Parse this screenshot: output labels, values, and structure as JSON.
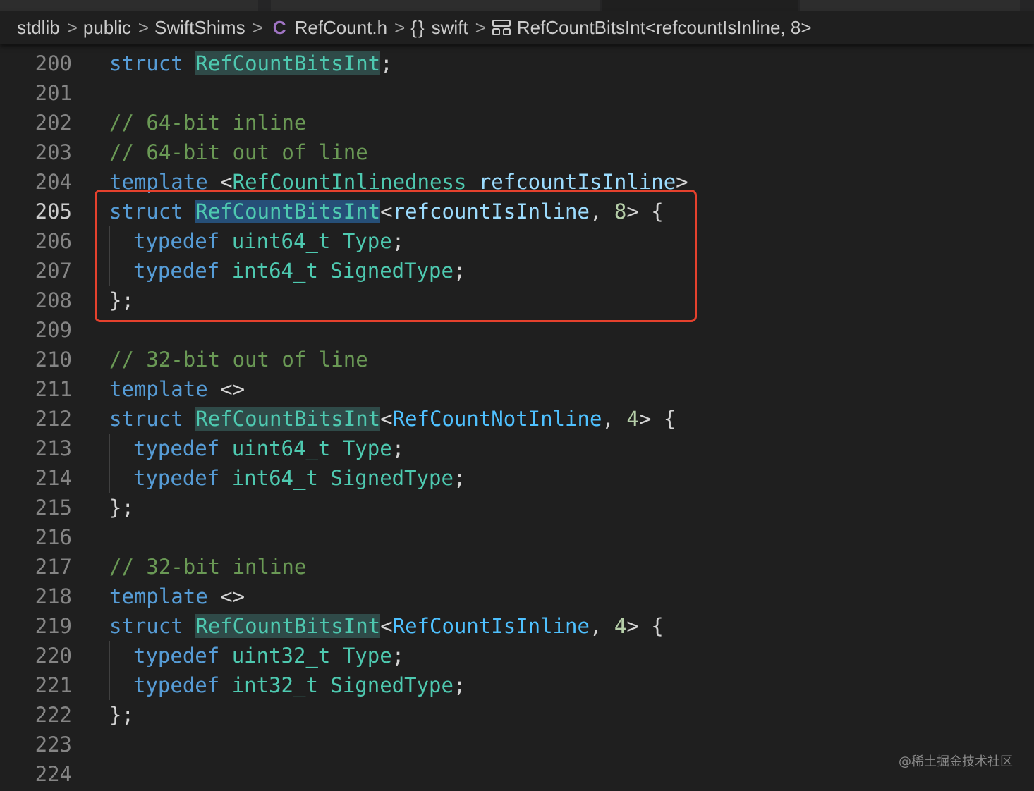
{
  "breadcrumb": {
    "items": [
      "stdlib",
      "public",
      "SwiftShims",
      "RefCount.h",
      "swift",
      "RefCountBitsInt<refcountIsInline, 8>"
    ],
    "separator": ">",
    "c_icon": "C",
    "brace_icon": "{}"
  },
  "editor": {
    "lines": [
      {
        "n": "200",
        "tokens": [
          [
            "kw",
            "struct"
          ],
          [
            "pu",
            " "
          ],
          [
            "ty-hl",
            "RefCountBitsInt"
          ],
          [
            "pu",
            ";"
          ]
        ]
      },
      {
        "n": "201",
        "tokens": []
      },
      {
        "n": "202",
        "tokens": [
          [
            "cm",
            "// 64-bit inline"
          ]
        ]
      },
      {
        "n": "203",
        "tokens": [
          [
            "cm",
            "// 64-bit out of line"
          ]
        ]
      },
      {
        "n": "204",
        "tokens": [
          [
            "kw",
            "template"
          ],
          [
            "pu",
            " <"
          ],
          [
            "ty",
            "RefCountInlinedness"
          ],
          [
            "pu",
            " "
          ],
          [
            "pa",
            "refcountIsInline"
          ],
          [
            "pu",
            ">"
          ]
        ]
      },
      {
        "n": "205",
        "active": true,
        "tokens": [
          [
            "kw",
            "struct"
          ],
          [
            "pu",
            " "
          ],
          [
            "ty-sel",
            "RefCountBitsInt"
          ],
          [
            "pu",
            "<"
          ],
          [
            "pa",
            "refcountIsInline"
          ],
          [
            "pu",
            ", "
          ],
          [
            "nu",
            "8"
          ],
          [
            "pu",
            "> {"
          ]
        ]
      },
      {
        "n": "206",
        "indent": true,
        "tokens": [
          [
            "kw",
            "typedef"
          ],
          [
            "pu",
            " "
          ],
          [
            "ty",
            "uint64_t"
          ],
          [
            "pu",
            " "
          ],
          [
            "ty",
            "Type"
          ],
          [
            "pu",
            ";"
          ]
        ]
      },
      {
        "n": "207",
        "indent": true,
        "tokens": [
          [
            "kw",
            "typedef"
          ],
          [
            "pu",
            " "
          ],
          [
            "ty",
            "int64_t"
          ],
          [
            "pu",
            " "
          ],
          [
            "ty",
            "SignedType"
          ],
          [
            "pu",
            ";"
          ]
        ]
      },
      {
        "n": "208",
        "tokens": [
          [
            "pu",
            "};"
          ]
        ]
      },
      {
        "n": "209",
        "tokens": []
      },
      {
        "n": "210",
        "tokens": [
          [
            "cm",
            "// 32-bit out of line"
          ]
        ]
      },
      {
        "n": "211",
        "tokens": [
          [
            "kw",
            "template"
          ],
          [
            "pu",
            " <>"
          ]
        ]
      },
      {
        "n": "212",
        "tokens": [
          [
            "kw",
            "struct"
          ],
          [
            "pu",
            " "
          ],
          [
            "ty-hl",
            "RefCountBitsInt"
          ],
          [
            "pu",
            "<"
          ],
          [
            "en",
            "RefCountNotInline"
          ],
          [
            "pu",
            ", "
          ],
          [
            "nu",
            "4"
          ],
          [
            "pu",
            "> {"
          ]
        ]
      },
      {
        "n": "213",
        "indent": true,
        "tokens": [
          [
            "kw",
            "typedef"
          ],
          [
            "pu",
            " "
          ],
          [
            "ty",
            "uint64_t"
          ],
          [
            "pu",
            " "
          ],
          [
            "ty",
            "Type"
          ],
          [
            "pu",
            ";"
          ]
        ]
      },
      {
        "n": "214",
        "indent": true,
        "tokens": [
          [
            "kw",
            "typedef"
          ],
          [
            "pu",
            " "
          ],
          [
            "ty",
            "int64_t"
          ],
          [
            "pu",
            " "
          ],
          [
            "ty",
            "SignedType"
          ],
          [
            "pu",
            ";"
          ]
        ]
      },
      {
        "n": "215",
        "tokens": [
          [
            "pu",
            "};"
          ]
        ]
      },
      {
        "n": "216",
        "tokens": []
      },
      {
        "n": "217",
        "tokens": [
          [
            "cm",
            "// 32-bit inline"
          ]
        ]
      },
      {
        "n": "218",
        "tokens": [
          [
            "kw",
            "template"
          ],
          [
            "pu",
            " <>"
          ]
        ]
      },
      {
        "n": "219",
        "tokens": [
          [
            "kw",
            "struct"
          ],
          [
            "pu",
            " "
          ],
          [
            "ty-hl",
            "RefCountBitsInt"
          ],
          [
            "pu",
            "<"
          ],
          [
            "en",
            "RefCountIsInline"
          ],
          [
            "pu",
            ", "
          ],
          [
            "nu",
            "4"
          ],
          [
            "pu",
            "> {"
          ]
        ]
      },
      {
        "n": "220",
        "indent": true,
        "tokens": [
          [
            "kw",
            "typedef"
          ],
          [
            "pu",
            " "
          ],
          [
            "ty",
            "uint32_t"
          ],
          [
            "pu",
            " "
          ],
          [
            "ty",
            "Type"
          ],
          [
            "pu",
            ";"
          ]
        ]
      },
      {
        "n": "221",
        "indent": true,
        "tokens": [
          [
            "kw",
            "typedef"
          ],
          [
            "pu",
            " "
          ],
          [
            "ty",
            "int32_t"
          ],
          [
            "pu",
            " "
          ],
          [
            "ty",
            "SignedType"
          ],
          [
            "pu",
            ";"
          ]
        ]
      },
      {
        "n": "222",
        "tokens": [
          [
            "pu",
            "};"
          ]
        ]
      },
      {
        "n": "223",
        "tokens": []
      },
      {
        "n": "224",
        "tokens": []
      }
    ]
  },
  "colors": {
    "background": "#1f1f1f",
    "keyword": "#569cd6",
    "type": "#4ec9b0",
    "comment": "#6a9955",
    "number": "#b5cea8",
    "parameter": "#9cdcfe",
    "enum_member": "#4fc1ff",
    "annotation_box": "#e5412d"
  },
  "watermark": "@稀土掘金技术社区"
}
